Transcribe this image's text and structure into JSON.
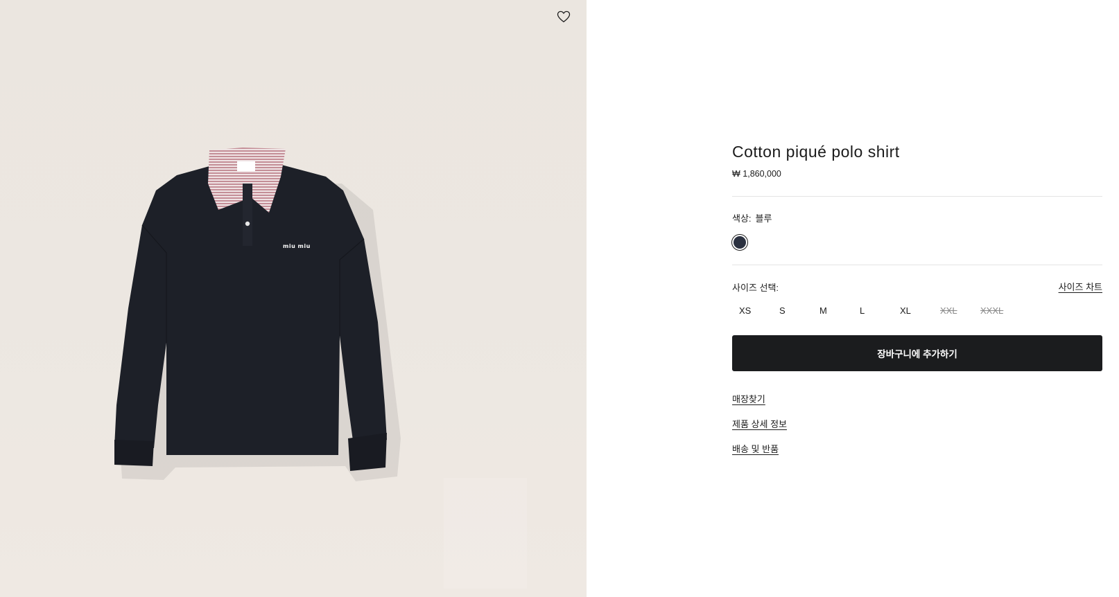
{
  "product": {
    "title": "Cotton piqué polo shirt",
    "price": "₩ 1,860,000"
  },
  "color": {
    "label": "색상:",
    "value": "블루",
    "swatches": [
      {
        "name": "블루",
        "hex": "#2b3140",
        "selected": true
      }
    ]
  },
  "size": {
    "label": "사이즈 선택:",
    "chart_link": "사이즈 차트",
    "options": [
      {
        "label": "XS",
        "available": true
      },
      {
        "label": "S",
        "available": true
      },
      {
        "label": "M",
        "available": true
      },
      {
        "label": "L",
        "available": true
      },
      {
        "label": "XL",
        "available": true
      },
      {
        "label": "XXL",
        "available": false
      },
      {
        "label": "XXXL",
        "available": false
      }
    ]
  },
  "actions": {
    "add_to_cart": "장바구니에 추가하기"
  },
  "links": {
    "find_store": "매장찾기",
    "product_details": "제품 상세 정보",
    "shipping_returns": "배송 및 반품"
  },
  "image": {
    "logo_text": "miu miu",
    "icons": {
      "wishlist": "heart-outline-icon"
    },
    "colors": {
      "background": "#ebe6e0",
      "shirt": "#1d2028",
      "collar": "#c79aa2",
      "button_primary": "#1b1c1e"
    }
  }
}
